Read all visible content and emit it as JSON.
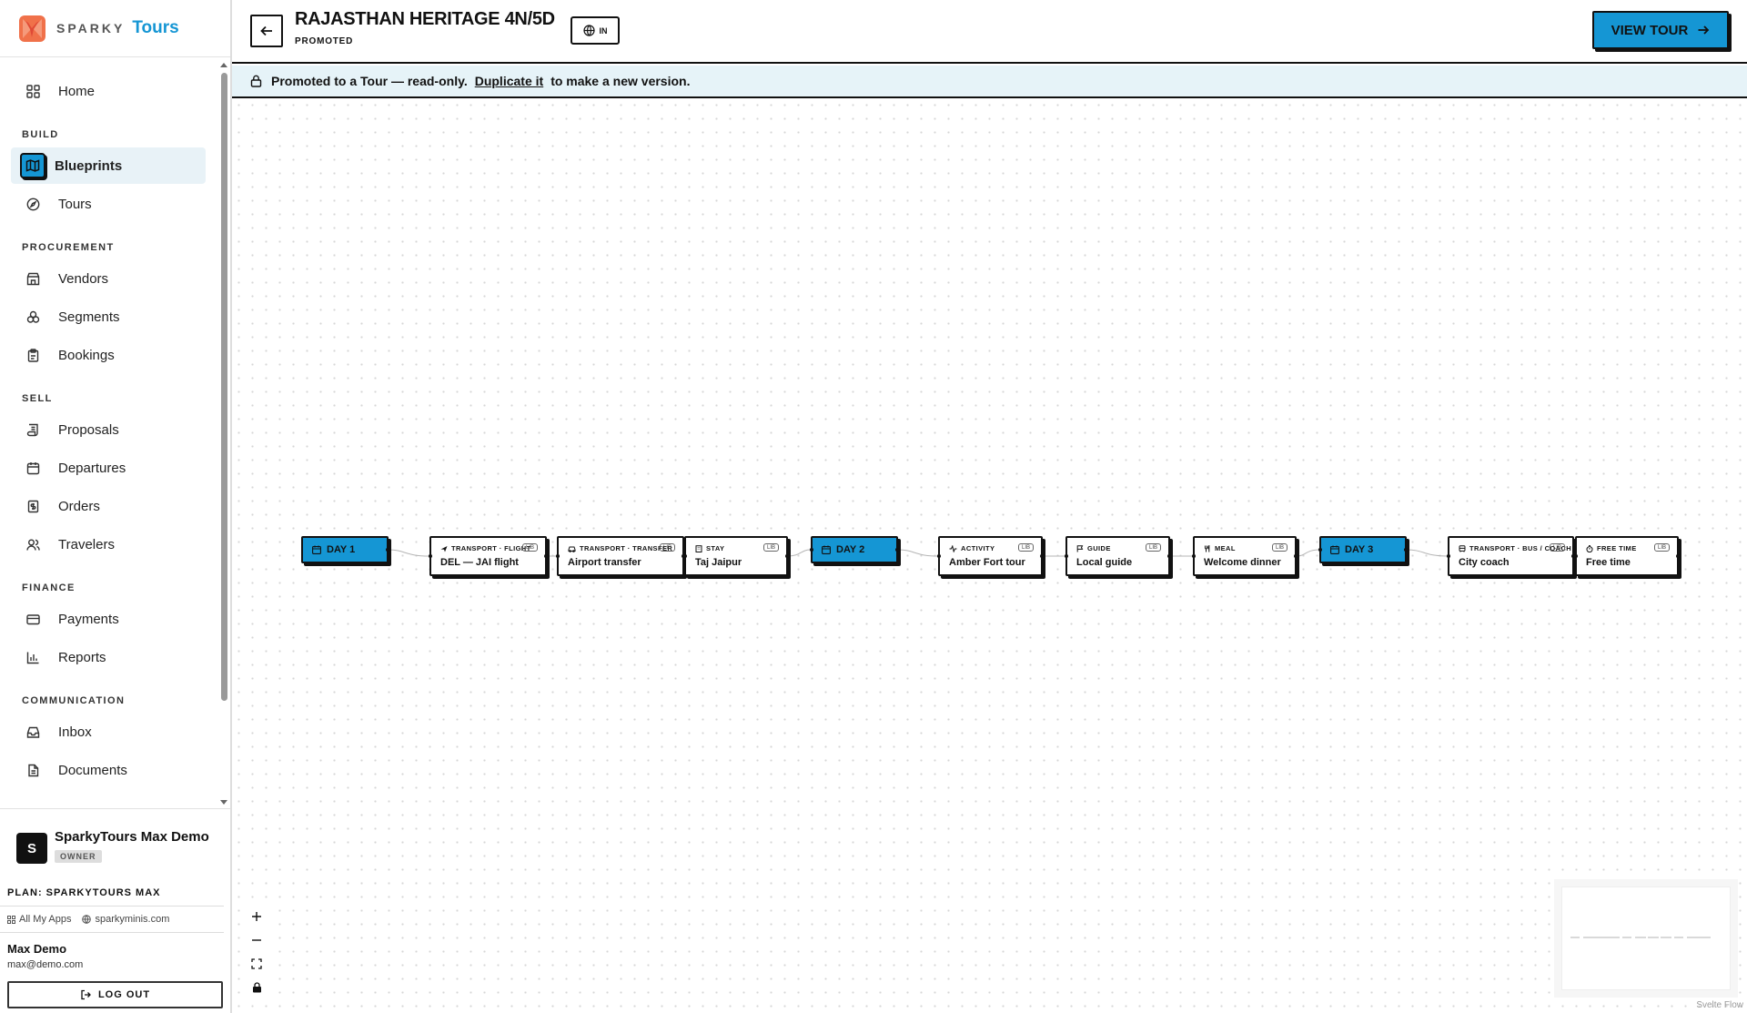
{
  "brand": {
    "name_small": "SPARKY",
    "name_large": "Tours",
    "accent": "#1596d4"
  },
  "nav": {
    "home": "Home",
    "sections": {
      "build": "BUILD",
      "procurement": "PROCUREMENT",
      "sell": "SELL",
      "finance": "FINANCE",
      "communication": "COMMUNICATION"
    },
    "items": {
      "blueprints": "Blueprints",
      "tours": "Tours",
      "vendors": "Vendors",
      "segments": "Segments",
      "bookings": "Bookings",
      "proposals": "Proposals",
      "departures": "Departures",
      "orders": "Orders",
      "travelers": "Travelers",
      "payments": "Payments",
      "reports": "Reports",
      "inbox": "Inbox",
      "documents": "Documents"
    }
  },
  "account": {
    "org_initial": "S",
    "org_name": "SparkyTours Max Demo",
    "role": "OWNER",
    "plan": "PLAN: SPARKYTOURS MAX",
    "link_apps": "All My Apps",
    "link_site": "sparkyminis.com",
    "user_name": "Max Demo",
    "user_email": "max@demo.com",
    "logout": "LOG OUT"
  },
  "header": {
    "title": "RAJASTHAN HERITAGE 4N/5D",
    "status": "PROMOTED",
    "region": "IN",
    "view_tour": "VIEW TOUR"
  },
  "banner": {
    "text_before": "Promoted to a Tour — read-only.",
    "link": "Duplicate it",
    "text_after": "to make a new version."
  },
  "flow": {
    "badge": "LIB",
    "days": [
      "DAY 1",
      "DAY 2",
      "DAY 3"
    ],
    "nodes": [
      {
        "category": "TRANSPORT · FLIGHT",
        "name": "DEL — JAI flight",
        "icon": "plane-icon"
      },
      {
        "category": "TRANSPORT · TRANSFER",
        "name": "Airport transfer",
        "icon": "car-icon"
      },
      {
        "category": "STAY",
        "name": "Taj Jaipur",
        "icon": "building-icon"
      },
      {
        "category": "ACTIVITY",
        "name": "Amber Fort tour",
        "icon": "activity-icon"
      },
      {
        "category": "GUIDE",
        "name": "Local guide",
        "icon": "flag-icon"
      },
      {
        "category": "MEAL",
        "name": "Welcome dinner",
        "icon": "utensils-icon"
      },
      {
        "category": "TRANSPORT · BUS / COACH",
        "name": "City coach",
        "icon": "bus-icon"
      },
      {
        "category": "FREE TIME",
        "name": "Free time",
        "icon": "timer-icon"
      }
    ],
    "attribution": "Svelte Flow"
  }
}
